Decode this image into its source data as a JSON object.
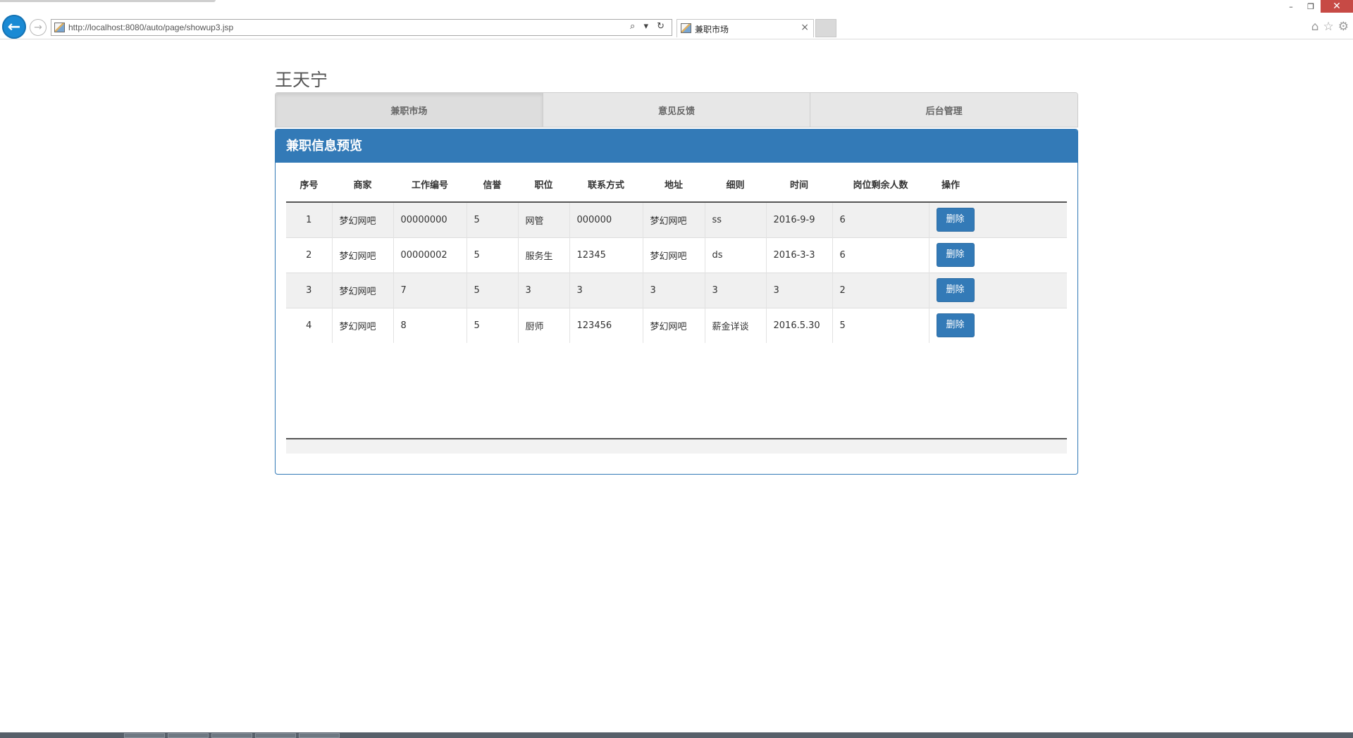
{
  "browser": {
    "url": "http://localhost:8080/auto/page/showup3.jsp",
    "tab_title": "兼职市场",
    "tab_close": "×",
    "back_glyph": "←",
    "forward_glyph": "→",
    "address_tools": "⌕ ▾ ↻",
    "window_controls": {
      "minimize": "–",
      "restore": "❐",
      "close": "✕"
    },
    "tools": {
      "home": "⌂",
      "favorites": "☆",
      "settings": "⚙"
    }
  },
  "page": {
    "title": "王天宁",
    "nav": [
      "兼职市场",
      "意见反馈",
      "后台管理"
    ],
    "panel_title": "兼职信息预览"
  },
  "table": {
    "columns": [
      "序号",
      "商家",
      "工作编号",
      "信誉",
      "职位",
      "联系方式",
      "地址",
      "细则",
      "时间",
      "岗位剩余人数",
      "操作"
    ],
    "delete_label": "删除",
    "rows": [
      [
        "1",
        "梦幻网吧",
        "00000000",
        "5",
        "网管",
        "000000",
        "梦幻网吧",
        "ss",
        "2016-9-9",
        "6"
      ],
      [
        "2",
        "梦幻网吧",
        "00000002",
        "5",
        "服务生",
        "12345",
        "梦幻网吧",
        "ds",
        "2016-3-3",
        "6"
      ],
      [
        "3",
        "梦幻网吧",
        "7",
        "5",
        "3",
        "3",
        "3",
        "3",
        "3",
        "2"
      ],
      [
        "4",
        "梦幻网吧",
        "8",
        "5",
        "厨师",
        "123456",
        "梦幻网吧",
        "薪金详谈",
        "2016.5.30",
        "5"
      ]
    ]
  },
  "colors": {
    "primary": "#337ab7",
    "stripe": "#f0f0f0",
    "tab_bg": "#e7e7e7"
  }
}
